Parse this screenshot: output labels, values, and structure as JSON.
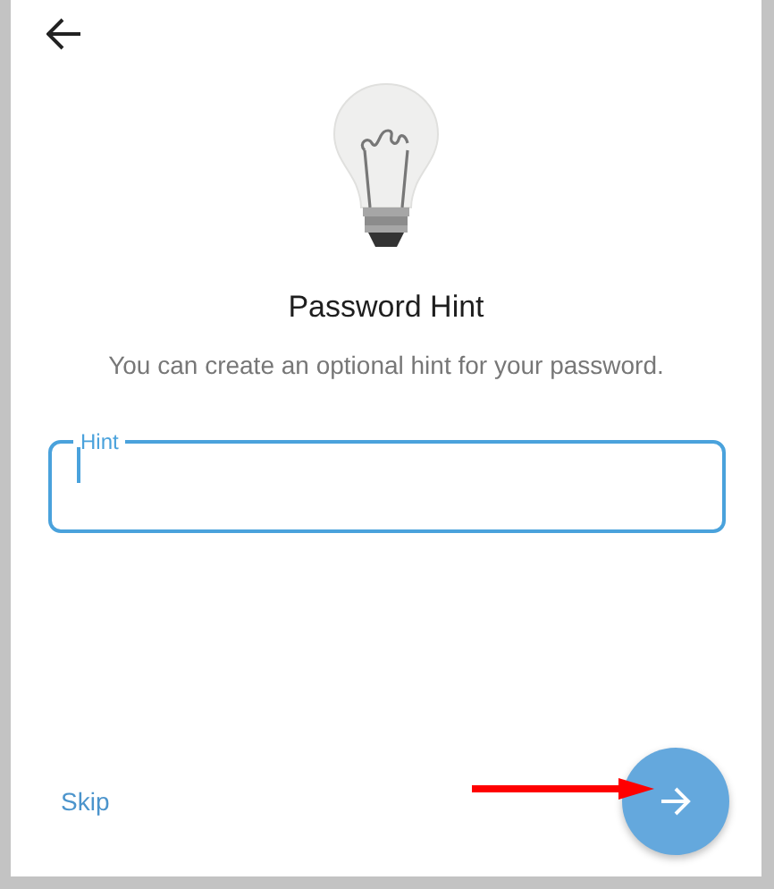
{
  "title": "Password Hint",
  "subtitle": "You can create an optional hint for your password.",
  "hint_field": {
    "label": "Hint",
    "focused": true
  },
  "skip": "Skip"
}
